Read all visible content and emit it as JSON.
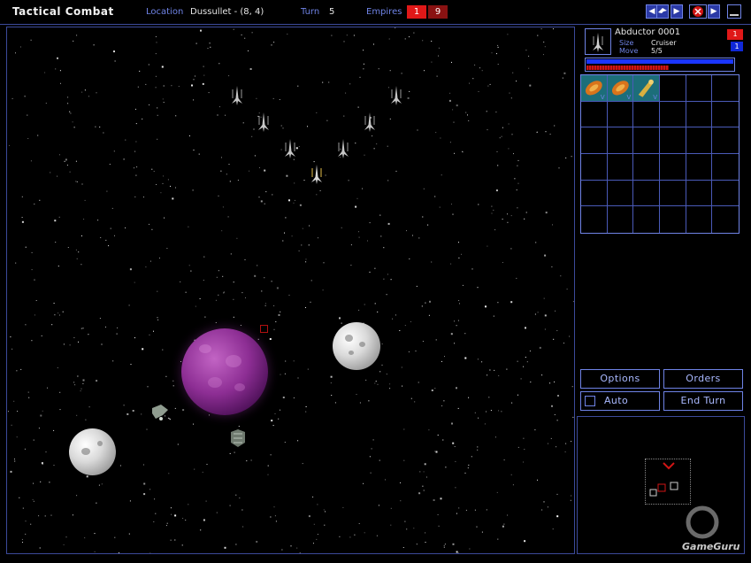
{
  "topbar": {
    "title": "Tactical Combat",
    "location_label": "Location",
    "location_value": "Dussullet - (8, 4)",
    "turn_label": "Turn",
    "turn_value": "5",
    "empires_label": "Empires",
    "empires": [
      {
        "count": "1",
        "color": "#e01818"
      },
      {
        "count": "9",
        "color": "#8a1212"
      }
    ]
  },
  "ship": {
    "name": "Abductor  0001",
    "size_label": "Size",
    "size_value": "Cruiser",
    "move_label": "Move",
    "move_value": "5/5",
    "badge_red": "1",
    "badge_blue": "1",
    "shield_fraction": 1.0,
    "structure_fraction": 0.56
  },
  "components": [
    {
      "icon": "engine-icon",
      "tag": "V"
    },
    {
      "icon": "engine-icon",
      "tag": "V"
    },
    {
      "icon": "weapon-icon",
      "tag": "V"
    }
  ],
  "buttons": {
    "options": "Options",
    "orders": "Orders",
    "auto": "Auto",
    "end_turn": "End Turn"
  },
  "logo_text": "GameGuru",
  "colors": {
    "accent": "#6f83e6",
    "enemy_red": "#e01818",
    "friendly_blue": "#1028d8"
  }
}
